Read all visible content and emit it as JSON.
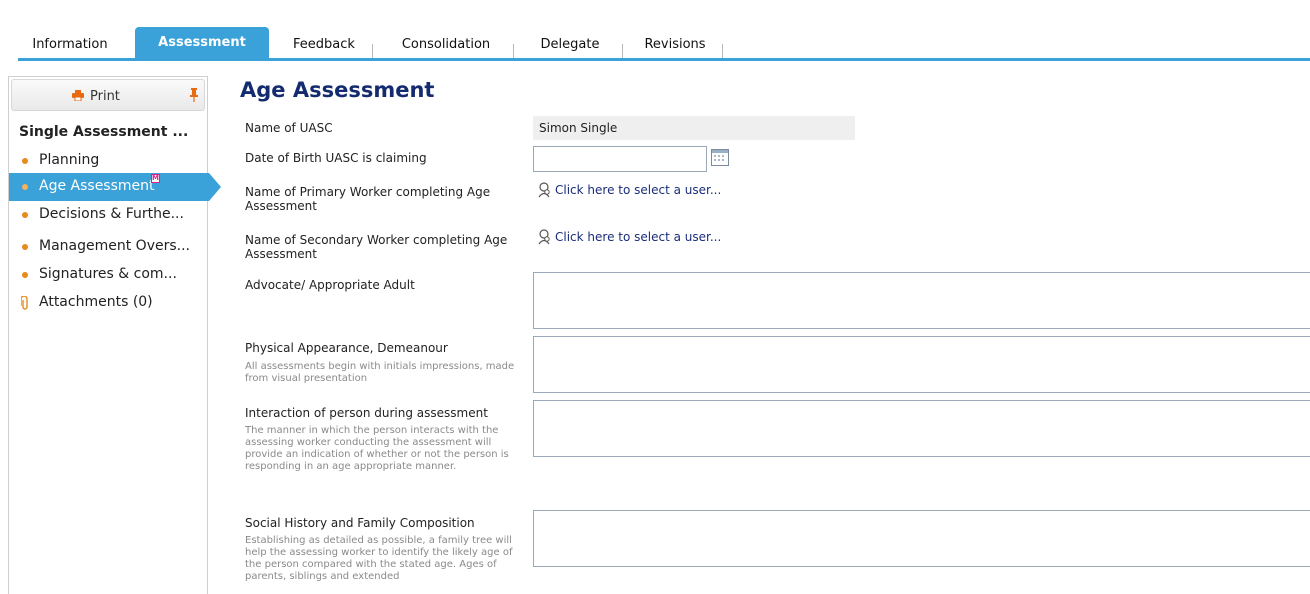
{
  "tabs": [
    {
      "label": "Information"
    },
    {
      "label": "Assessment"
    },
    {
      "label": "Feedback"
    },
    {
      "label": "Consolidation"
    },
    {
      "label": "Delegate"
    },
    {
      "label": "Revisions"
    }
  ],
  "sidebar": {
    "print_label": "Print",
    "tree_title": "Single Assessment ...",
    "items": [
      {
        "label": "Planning"
      },
      {
        "label": "Age Assessment",
        "badge": "M"
      },
      {
        "label": "Decisions & Furthe..."
      },
      {
        "label": "Management Overs..."
      },
      {
        "label": "Signatures & com..."
      }
    ],
    "attachments_label": "Attachments (0)"
  },
  "page": {
    "title": "Age Assessment"
  },
  "form": {
    "name_label": "Name of UASC",
    "name_value": "Simon Single",
    "dob_label": "Date of Birth UASC is claiming",
    "dob_value": "",
    "primary_label": "Name of Primary Worker completing Age Assessment",
    "primary_link": "Click here to select a user...",
    "secondary_label": "Name of Secondary Worker completing Age Assessment",
    "secondary_link": "Click here to select a user...",
    "advocate_label": "Advocate/ Appropriate Adult",
    "appearance_label": "Physical Appearance, Demeanour",
    "appearance_help": "All assessments begin with initials impressions, made from visual presentation",
    "interaction_label": "Interaction of person during assessment",
    "interaction_help": "The manner in which the person interacts with the assessing worker conducting the assessment will provide an indication of whether or not the person is responding in an age appropriate manner.",
    "social_label": "Social History and Family Composition",
    "social_help": "Establishing as detailed as possible, a family tree will help the assessing worker to identify the likely age of the person compared with the stated age. Ages of parents, siblings and extended"
  },
  "colors": {
    "accent": "#3aa2d8",
    "title": "#142b6f",
    "bullet": "#e88a1a"
  }
}
